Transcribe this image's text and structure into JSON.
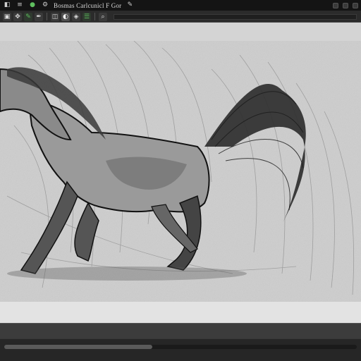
{
  "menubar": {
    "title": "Bosmas Carlcunicl F Gor",
    "icons": [
      "app-icon",
      "menu-icon",
      "green-icon",
      "settings-icon"
    ]
  },
  "toolbar": {
    "tools": [
      "select-tool",
      "brush-tool",
      "eraser-tool",
      "color-tool",
      "layer-tool"
    ]
  },
  "canvas": {
    "subject": "",
    "background": "#dcdcdc",
    "ink": "#111111"
  },
  "colors": {
    "chrome_dark": "#141414",
    "chrome_mid": "#2b2b2b",
    "accent_green": "#5fbf5f",
    "paper": "#dcdcdc"
  }
}
